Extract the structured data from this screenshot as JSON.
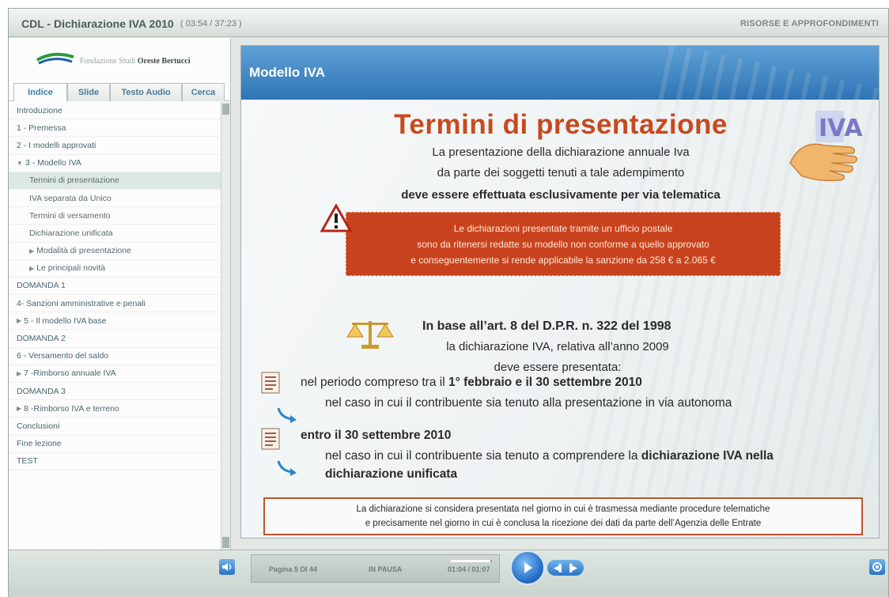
{
  "app": {
    "title": "CDL - Dichiarazione IVA 2010",
    "time": "( 03:54 / 37:23 )",
    "resources": "RISORSE E APPROFONDIMENTI"
  },
  "logo": {
    "prefix": "Fondazione Studi ",
    "name": "Oreste Bertucci"
  },
  "tabs": [
    "Indice",
    "Slide",
    "Testo Audio",
    "Cerca"
  ],
  "index": [
    {
      "label": "Introduzione",
      "level": 0,
      "arrow": ""
    },
    {
      "label": "1 - Premessa",
      "level": 0,
      "arrow": ""
    },
    {
      "label": "2 - I modelli approvati",
      "level": 0,
      "arrow": ""
    },
    {
      "label": "3 - Modello IVA",
      "level": 0,
      "arrow": "▼"
    },
    {
      "label": "Termini di presentazione",
      "level": 1,
      "arrow": "",
      "selected": true
    },
    {
      "label": "IVA separata da Unico",
      "level": 1,
      "arrow": ""
    },
    {
      "label": "Termini di versamento",
      "level": 1,
      "arrow": ""
    },
    {
      "label": "Dichiarazione unificata",
      "level": 1,
      "arrow": ""
    },
    {
      "label": "Modalità di presentazione",
      "level": 1,
      "arrow": "▶"
    },
    {
      "label": "Le principali novità",
      "level": 1,
      "arrow": "▶"
    },
    {
      "label": "DOMANDA 1",
      "level": 0,
      "arrow": ""
    },
    {
      "label": "4- Sanzioni amministrative e penali",
      "level": 0,
      "arrow": ""
    },
    {
      "label": "5 - Il modello IVA base",
      "level": 0,
      "arrow": "▶"
    },
    {
      "label": "DOMANDA 2",
      "level": 0,
      "arrow": ""
    },
    {
      "label": "6 - Versamento del saldo",
      "level": 0,
      "arrow": ""
    },
    {
      "label": "7 -Rimborso annuale IVA",
      "level": 0,
      "arrow": "▶"
    },
    {
      "label": "DOMANDA 3",
      "level": 0,
      "arrow": ""
    },
    {
      "label": "8 -Rimborso IVA e terreno",
      "level": 0,
      "arrow": "▶"
    },
    {
      "label": "Conclusioni",
      "level": 0,
      "arrow": ""
    },
    {
      "label": "Fine lezione",
      "level": 0,
      "arrow": ""
    },
    {
      "label": "TEST",
      "level": 0,
      "arrow": ""
    }
  ],
  "slide": {
    "header": "Modello IVA",
    "title": "Termini di presentazione",
    "line1": "La presentazione della dichiarazione annuale Iva",
    "line2": "da parte dei soggetti tenuti a tale adempimento",
    "line3": "deve essere effettuata esclusivamente per via telematica",
    "red_lines": [
      "Le dichiarazioni presentate tramite un ufficio postale",
      "sono da ritenersi redatte su modello non conforme a quello approvato",
      "e conseguentemente si rende applicabile la sanzione da 258 € a 2.065 €"
    ],
    "art": "In base all’art. 8 del D.P.R. n. 322 del 1998",
    "art2": "la dichiarazione IVA, relativa all’anno 2009",
    "art3": "deve essere presentata:",
    "p1_prefix": "nel periodo compreso tra il ",
    "p1_bold": "1° febbraio e il 30 settembre 2010",
    "p1_sub": "nel caso in cui il contribuente sia tenuto alla presentazione in via autonoma",
    "p2_bold": "entro il 30 settembre 2010",
    "p2_sub_prefix": "nel caso in cui il contribuente sia tenuto a comprendere la ",
    "p2_sub_bold": "dichiarazione IVA nella",
    "p2_sub_bold2": "dichiarazione unificata",
    "note1": "La dichiarazione si considera presentata nel giorno in cui è trasmessa mediante procedure telematiche",
    "note2": "e precisamente nel giorno in cui è conclusa la ricezione dei dati da parte dell’Agenzia delle Entrate"
  },
  "player": {
    "page": "Pagina 5 DI 44",
    "state": "IN PAUSA",
    "time": "01:04 / 01:07",
    "progress": 0.96
  }
}
